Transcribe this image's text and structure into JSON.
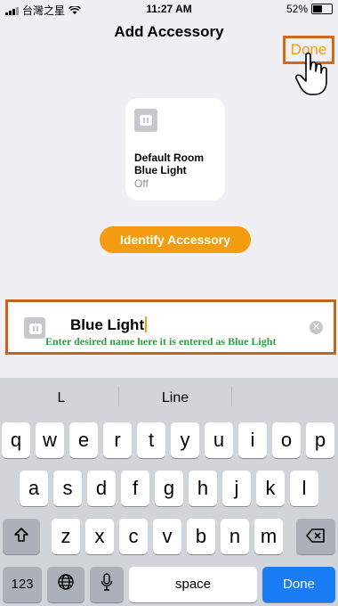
{
  "status_bar": {
    "carrier": "台灣之星",
    "time": "11:27 AM",
    "battery_text": "52%",
    "battery_level": 0.52
  },
  "nav": {
    "title": "Add Accessory",
    "done_label": "Done"
  },
  "accessory_card": {
    "room": "Default Room",
    "name": "Blue Light",
    "state": "Off",
    "icon": "outlet-icon"
  },
  "identify_label": "Identify Accessory",
  "name_field": {
    "value": "Blue Light",
    "annotation": "Enter desired name here it is entered as Blue Light"
  },
  "keyboard": {
    "suggestions": [
      "L",
      "Line",
      ""
    ],
    "row1": [
      "q",
      "w",
      "e",
      "r",
      "t",
      "y",
      "u",
      "i",
      "o",
      "p"
    ],
    "row2": [
      "a",
      "s",
      "d",
      "f",
      "g",
      "h",
      "j",
      "k",
      "l"
    ],
    "row3": [
      "z",
      "x",
      "c",
      "v",
      "b",
      "n",
      "m"
    ],
    "numbers_label": "123",
    "space_label": "space",
    "done_label": "Done"
  },
  "colors": {
    "accent": "#f39c12",
    "highlight_border": "#c4651b",
    "annotation_green": "#2e9e3e",
    "keyboard_done": "#1a7cf5"
  }
}
